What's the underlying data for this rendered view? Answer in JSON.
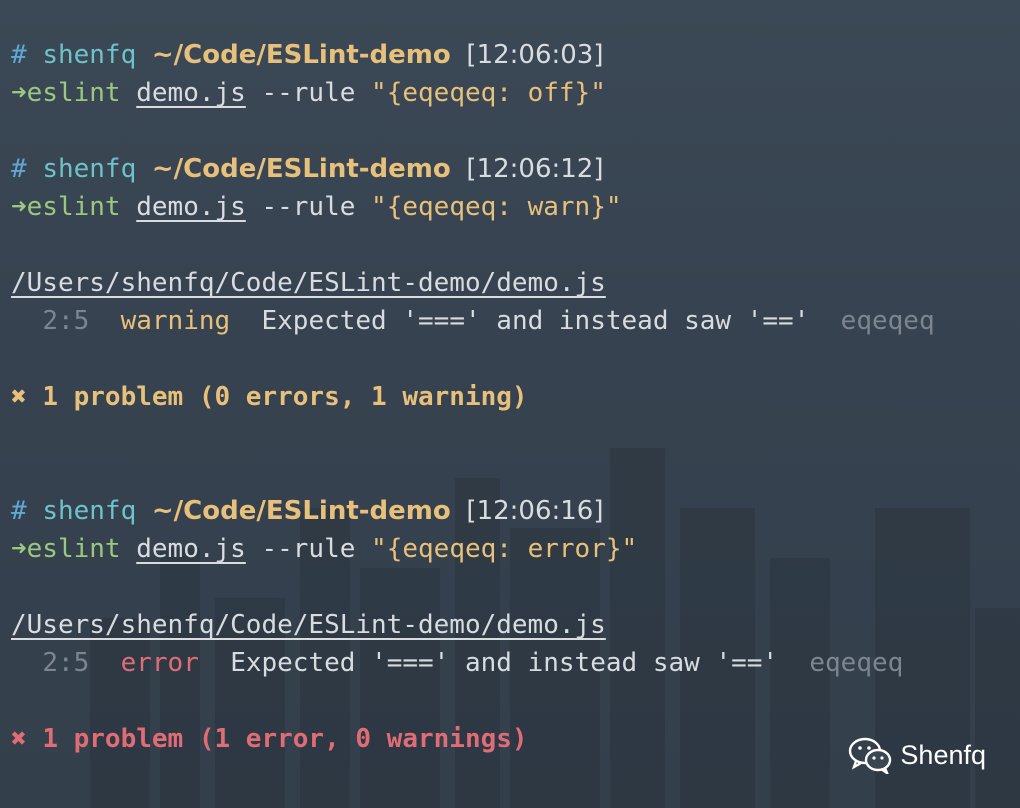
{
  "blocks": [
    {
      "prompt": {
        "hash": "#",
        "user": "shenfq",
        "path": "~/Code/ESLint-demo",
        "time": "[12:06:03]"
      },
      "command": {
        "arrow": "➜",
        "bin": "eslint",
        "file": "demo.js",
        "flag": "--rule",
        "value": "\"{eqeqeq: off}\""
      }
    },
    {
      "prompt": {
        "hash": "#",
        "user": "shenfq",
        "path": "~/Code/ESLint-demo",
        "time": "[12:06:12]"
      },
      "command": {
        "arrow": "➜",
        "bin": "eslint",
        "file": "demo.js",
        "flag": "--rule",
        "value": "\"{eqeqeq: warn}\""
      },
      "report": {
        "file": "/Users/shenfq/Code/ESLint-demo/demo.js",
        "position": "2:5",
        "severity": "warning",
        "message": "Expected '===' and instead saw '=='",
        "rule": "eqeqeq",
        "summary_icon": "✖",
        "summary": "1 problem (0 errors, 1 warning)"
      }
    },
    {
      "prompt": {
        "hash": "#",
        "user": "shenfq",
        "path": "~/Code/ESLint-demo",
        "time": "[12:06:16]"
      },
      "command": {
        "arrow": "➜",
        "bin": "eslint",
        "file": "demo.js",
        "flag": "--rule",
        "value": "\"{eqeqeq: error}\""
      },
      "report": {
        "file": "/Users/shenfq/Code/ESLint-demo/demo.js",
        "position": "2:5",
        "severity": "error",
        "message": "Expected '===' and instead saw '=='",
        "rule": "eqeqeq",
        "summary_icon": "✖",
        "summary": "1 problem (1 error, 0 warnings)"
      }
    }
  ],
  "watermark": {
    "icon": "wechat-icon",
    "text": "Shenfq"
  },
  "colors": {
    "warning": "#e7c07b",
    "error": "#e06c75",
    "prompt_path": "#e7c07b",
    "command": "#9bc77f"
  }
}
